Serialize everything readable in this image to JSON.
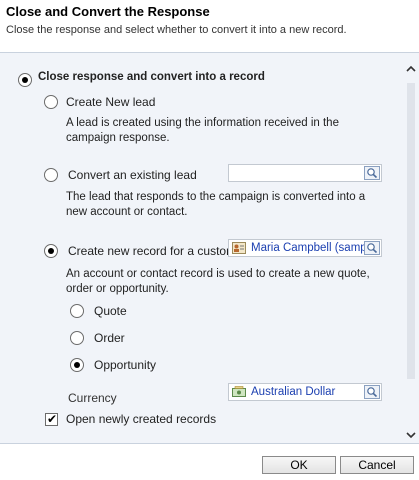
{
  "dialog": {
    "title": "Close and Convert the Response",
    "subtitle": "Close the response and select whether to convert it into a new record."
  },
  "main_option": {
    "label": "Close response and convert into a record",
    "selected": true
  },
  "options": {
    "create_lead": {
      "label": "Create New lead",
      "description": "A lead is created using the information received in the campaign response.",
      "selected": false
    },
    "convert_existing": {
      "label": "Convert an existing lead",
      "description": "The lead that responds to the campaign is converted into a new account or contact.",
      "lookup_value": "",
      "selected": false
    },
    "create_new_record": {
      "label": "Create new record for a customer",
      "description": "An account or contact record is used to create a new quote, order or opportunity.",
      "lookup_value": "Maria Campbell (sample)",
      "selected": true
    }
  },
  "record_types": [
    {
      "label": "Quote",
      "selected": false
    },
    {
      "label": "Order",
      "selected": false
    },
    {
      "label": "Opportunity",
      "selected": true
    }
  ],
  "currency": {
    "label": "Currency",
    "value": "Australian Dollar"
  },
  "open_records": {
    "label": "Open newly created records",
    "checked": true
  },
  "buttons": {
    "ok": "OK",
    "cancel": "Cancel"
  },
  "colors": {
    "content_bg": "#f1f4f9",
    "link_blue": "#1b3fb0"
  },
  "icons": {
    "lookup": "magnifier-lookup-icon",
    "contact": "contact-card-icon",
    "currency": "currency-icon"
  }
}
